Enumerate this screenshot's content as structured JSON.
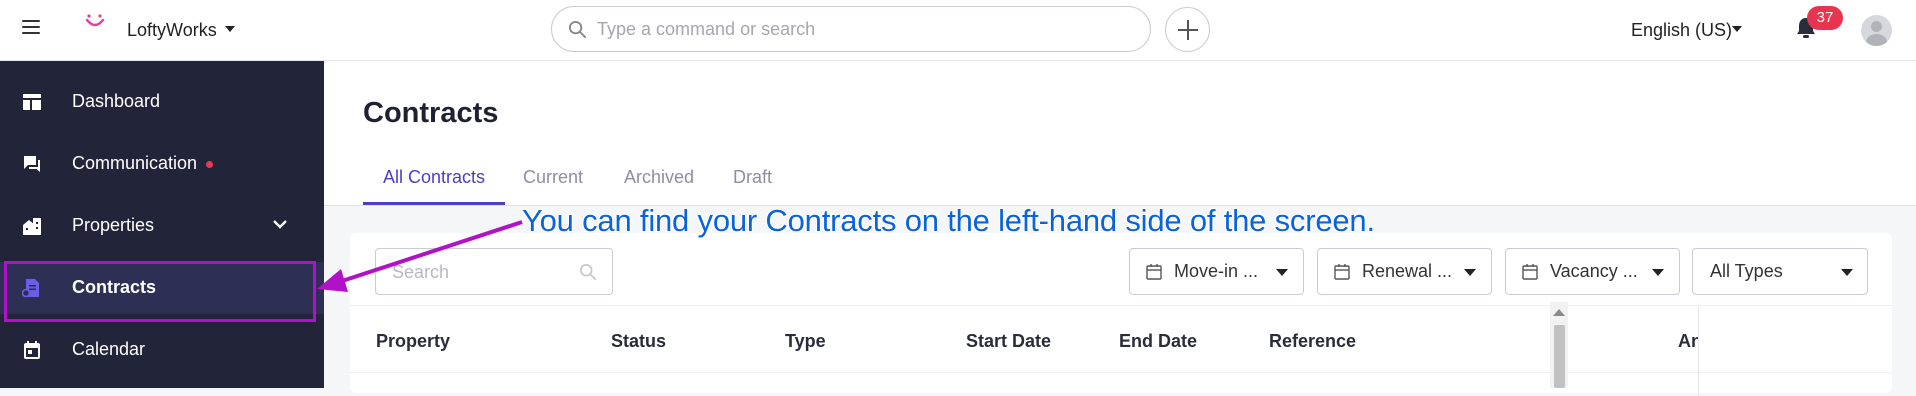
{
  "header": {
    "app_name": "LoftyWorks",
    "search_placeholder": "Type a command or search",
    "language": "English (US)",
    "notification_count": "37"
  },
  "sidebar": {
    "items": [
      {
        "label": "Dashboard",
        "icon": "dashboard-icon"
      },
      {
        "label": "Communication",
        "icon": "chat-icon",
        "has_dot": true
      },
      {
        "label": "Properties",
        "icon": "building-icon",
        "expandable": true
      },
      {
        "label": "Contracts",
        "icon": "contract-icon",
        "active": true
      },
      {
        "label": "Calendar",
        "icon": "calendar-icon"
      }
    ]
  },
  "page": {
    "title": "Contracts",
    "tabs": [
      "All Contracts",
      "Current",
      "Archived",
      "Draft"
    ],
    "active_tab": "All Contracts"
  },
  "filters": {
    "search_placeholder": "Search",
    "move_in": "Move-in ...",
    "renewal": "Renewal ...",
    "vacancy": "Vacancy ...",
    "types": "All Types"
  },
  "table": {
    "columns": [
      "Property",
      "Status",
      "Type",
      "Start Date",
      "End Date",
      "Reference",
      "An"
    ]
  },
  "annotation": {
    "text": "You can find your Contracts on the left-hand side of the screen."
  },
  "colors": {
    "sidebar_bg": "#22243a",
    "accent": "#4b3fc4",
    "highlight": "#b112c7",
    "annotation": "#0a63d8",
    "badge": "#e8344e"
  }
}
